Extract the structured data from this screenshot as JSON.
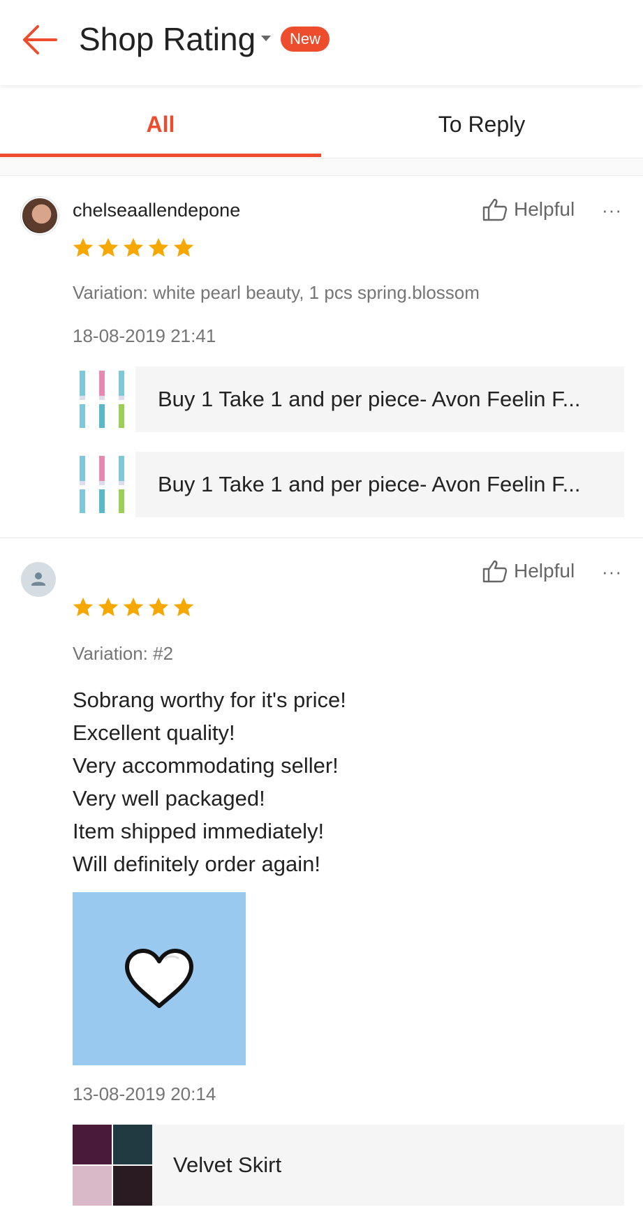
{
  "header": {
    "title": "Shop Rating",
    "badge": "New"
  },
  "tabs": [
    {
      "label": "All",
      "active": true
    },
    {
      "label": "To Reply",
      "active": false
    }
  ],
  "colors": {
    "accent": "#ee4d2d",
    "star": "#f6a700"
  },
  "reviews": [
    {
      "username": "chelseaallendepone",
      "rating": 5,
      "helpful_label": "Helpful",
      "more_label": "···",
      "variation": "Variation: white pearl beauty, 1 pcs spring.blossom",
      "date": "18-08-2019 21:41",
      "products": [
        {
          "name": "Buy 1 Take 1 and per piece- Avon Feelin F..."
        },
        {
          "name": "Buy 1 Take 1 and per piece- Avon Feelin F..."
        }
      ]
    },
    {
      "username": "",
      "rating": 5,
      "helpful_label": "Helpful",
      "more_label": "···",
      "variation": "Variation: #2",
      "comment_lines": [
        "Sobrang worthy for it's price!",
        "Excellent quality!",
        "Very accommodating seller!",
        "Very well packaged!",
        "Item shipped immediately!",
        "Will definitely order again!"
      ],
      "date": "13-08-2019 20:14",
      "products": [
        {
          "name": "Velvet Skirt"
        }
      ]
    }
  ]
}
